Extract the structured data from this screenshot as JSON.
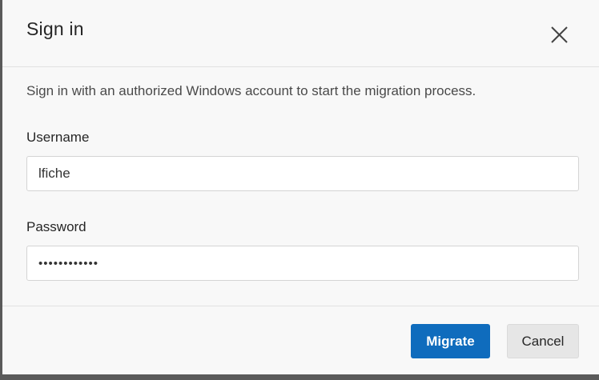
{
  "dialog": {
    "title": "Sign in",
    "close_icon": "close-icon",
    "description": "Sign in with an authorized Windows account to start the migration process.",
    "username": {
      "label": "Username",
      "value": "lfiche",
      "placeholder": ""
    },
    "password": {
      "label": "Password",
      "value": "••••••••••••",
      "placeholder": ""
    },
    "buttons": {
      "migrate": "Migrate",
      "cancel": "Cancel"
    },
    "colors": {
      "primary": "#0f6cbd",
      "dialog_bg": "#f8f8f8",
      "secondary_btn": "#e6e6e6"
    }
  }
}
